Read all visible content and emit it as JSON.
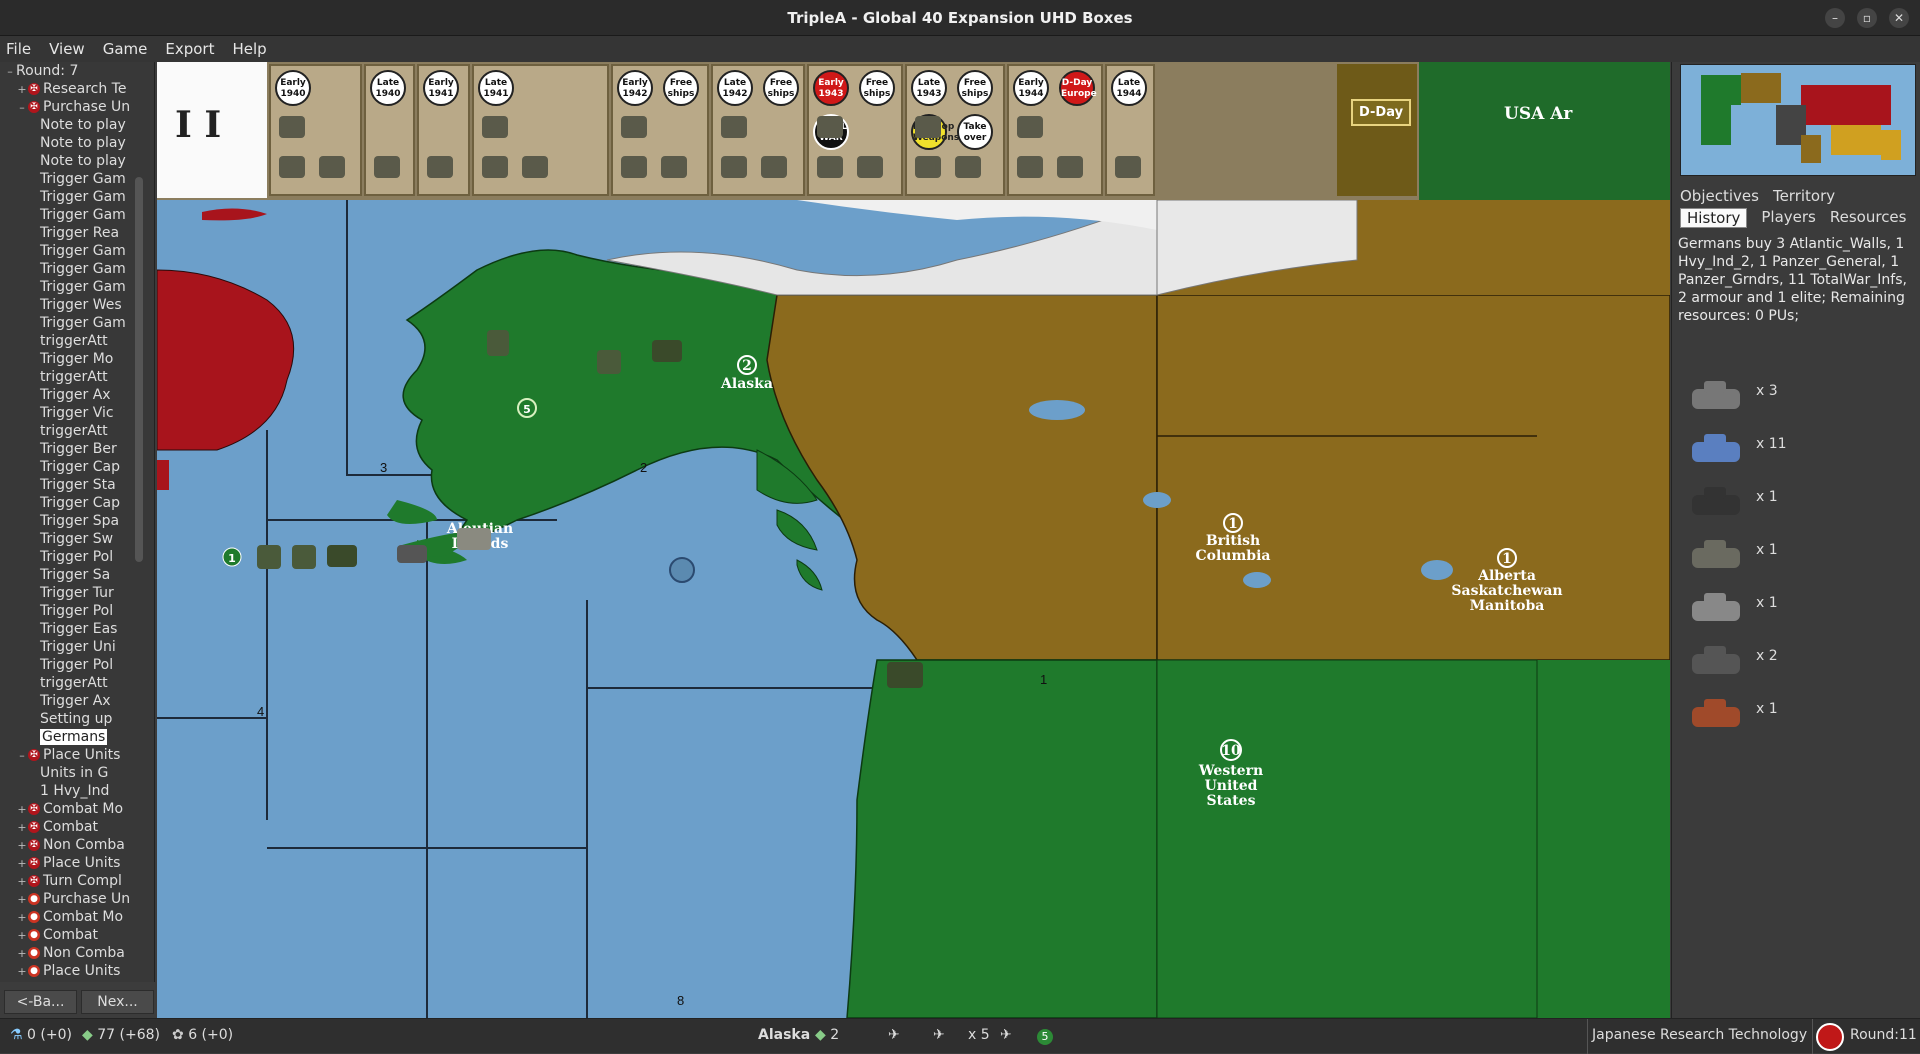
{
  "window": {
    "title": "TripleA - Global 40 Expansion UHD Boxes",
    "controls": [
      "–",
      "▫",
      "✕"
    ]
  },
  "menu": [
    "File",
    "View",
    "Game",
    "Export",
    "Help"
  ],
  "tree": {
    "items": [
      {
        "exp": "–",
        "icon": "",
        "label": "Round: 7",
        "indent": 0
      },
      {
        "exp": "+",
        "icon": "cross",
        "label": "Research Te",
        "indent": 1
      },
      {
        "exp": "–",
        "icon": "cross",
        "label": "Purchase Un",
        "indent": 1
      },
      {
        "exp": "",
        "icon": "",
        "label": "Note to play",
        "indent": 2
      },
      {
        "exp": "",
        "icon": "",
        "label": "Note to play",
        "indent": 2
      },
      {
        "exp": "",
        "icon": "",
        "label": "Note to play",
        "indent": 2
      },
      {
        "exp": "",
        "icon": "",
        "label": "Trigger Gam",
        "indent": 2
      },
      {
        "exp": "",
        "icon": "",
        "label": "Trigger Gam",
        "indent": 2
      },
      {
        "exp": "",
        "icon": "",
        "label": "Trigger Gam",
        "indent": 2
      },
      {
        "exp": "",
        "icon": "",
        "label": "Trigger Rea",
        "indent": 2
      },
      {
        "exp": "",
        "icon": "",
        "label": "Trigger Gam",
        "indent": 2
      },
      {
        "exp": "",
        "icon": "",
        "label": "Trigger Gam",
        "indent": 2
      },
      {
        "exp": "",
        "icon": "",
        "label": "Trigger Gam",
        "indent": 2
      },
      {
        "exp": "",
        "icon": "",
        "label": "Trigger Wes",
        "indent": 2
      },
      {
        "exp": "",
        "icon": "",
        "label": "Trigger Gam",
        "indent": 2
      },
      {
        "exp": "",
        "icon": "",
        "label": "triggerAtt",
        "indent": 2
      },
      {
        "exp": "",
        "icon": "",
        "label": "Trigger Mo",
        "indent": 2
      },
      {
        "exp": "",
        "icon": "",
        "label": "triggerAtt",
        "indent": 2
      },
      {
        "exp": "",
        "icon": "",
        "label": "Trigger Ax",
        "indent": 2
      },
      {
        "exp": "",
        "icon": "",
        "label": "Trigger Vic",
        "indent": 2
      },
      {
        "exp": "",
        "icon": "",
        "label": "triggerAtt",
        "indent": 2
      },
      {
        "exp": "",
        "icon": "",
        "label": "Trigger Ber",
        "indent": 2
      },
      {
        "exp": "",
        "icon": "",
        "label": "Trigger Cap",
        "indent": 2
      },
      {
        "exp": "",
        "icon": "",
        "label": "Trigger Sta",
        "indent": 2
      },
      {
        "exp": "",
        "icon": "",
        "label": "Trigger Cap",
        "indent": 2
      },
      {
        "exp": "",
        "icon": "",
        "label": "Trigger Spa",
        "indent": 2
      },
      {
        "exp": "",
        "icon": "",
        "label": "Trigger Sw",
        "indent": 2
      },
      {
        "exp": "",
        "icon": "",
        "label": "Trigger Pol",
        "indent": 2
      },
      {
        "exp": "",
        "icon": "",
        "label": "Trigger Sa",
        "indent": 2
      },
      {
        "exp": "",
        "icon": "",
        "label": "Trigger Tur",
        "indent": 2
      },
      {
        "exp": "",
        "icon": "",
        "label": "Trigger Pol",
        "indent": 2
      },
      {
        "exp": "",
        "icon": "",
        "label": "Trigger Eas",
        "indent": 2
      },
      {
        "exp": "",
        "icon": "",
        "label": "Trigger Uni",
        "indent": 2
      },
      {
        "exp": "",
        "icon": "",
        "label": "Trigger Pol",
        "indent": 2
      },
      {
        "exp": "",
        "icon": "",
        "label": "triggerAtt",
        "indent": 2
      },
      {
        "exp": "",
        "icon": "",
        "label": "Trigger Ax",
        "indent": 2
      },
      {
        "exp": "",
        "icon": "",
        "label": "Setting up",
        "indent": 2
      },
      {
        "exp": "",
        "icon": "",
        "label": "Germans",
        "indent": 2,
        "selected": true
      },
      {
        "exp": "–",
        "icon": "cross",
        "label": "Place Units",
        "indent": 1
      },
      {
        "exp": "",
        "icon": "",
        "label": "Units in G",
        "indent": 2
      },
      {
        "exp": "",
        "icon": "",
        "label": "1 Hvy_Ind",
        "indent": 2
      },
      {
        "exp": "+",
        "icon": "cross",
        "label": "Combat Mo",
        "indent": 1
      },
      {
        "exp": "+",
        "icon": "cross",
        "label": "Combat",
        "indent": 1
      },
      {
        "exp": "+",
        "icon": "cross",
        "label": "Non Comba",
        "indent": 1
      },
      {
        "exp": "+",
        "icon": "cross",
        "label": "Place Units",
        "indent": 1
      },
      {
        "exp": "+",
        "icon": "cross",
        "label": "Turn Compl",
        "indent": 1
      },
      {
        "exp": "+",
        "icon": "jp",
        "label": "Purchase Un",
        "indent": 1
      },
      {
        "exp": "+",
        "icon": "jp",
        "label": "Combat Mo",
        "indent": 1
      },
      {
        "exp": "+",
        "icon": "jp",
        "label": "Combat",
        "indent": 1
      },
      {
        "exp": "+",
        "icon": "jp",
        "label": "Non Comba",
        "indent": 1
      },
      {
        "exp": "+",
        "icon": "jp",
        "label": "Place Units",
        "indent": 1
      }
    ],
    "back_label": "<-Ba...",
    "next_label": "Nex..."
  },
  "tech_strip": {
    "roman": "I I",
    "boxes": [
      {
        "badges": [
          "Early 1940"
        ]
      },
      {
        "badges": [
          "Late 1940"
        ]
      },
      {
        "badges": [
          "Early 1941"
        ]
      },
      {
        "badges": [
          "Late 1941"
        ]
      },
      {
        "badges": [
          "Early 1942",
          "Free ships"
        ]
      },
      {
        "badges": [
          "Late 1942",
          "Free ships"
        ]
      },
      {
        "badges": [
          "Early 1943",
          "Free ships",
          "TOTAL WAR"
        ]
      },
      {
        "badges": [
          "Late 1943",
          "Free ships",
          "Develop Weapons",
          "Take over"
        ]
      },
      {
        "badges": [
          "Early 1944",
          "D-Day Europe"
        ]
      },
      {
        "badges": [
          "Late 1944"
        ]
      }
    ],
    "dday_label": "D-Day",
    "usa_label": "USA Ar"
  },
  "map": {
    "territories": [
      {
        "name": "Alaska",
        "value": "2"
      },
      {
        "name": "British Columbia",
        "value": "1"
      },
      {
        "name": "Alberta Saskatchewan Manitoba",
        "value": "1"
      },
      {
        "name": "Western United States",
        "value": "10"
      },
      {
        "name": "Aleutian Islands",
        "value": ""
      }
    ],
    "sea_zone_numbers": [
      "3",
      "2",
      "4",
      "1",
      "8"
    ],
    "unit_counts": [
      "5",
      "5",
      "1",
      "3",
      "2"
    ]
  },
  "right_panel": {
    "tabs_row1": [
      "Objectives",
      "Territory"
    ],
    "tabs_row2": [
      "History",
      "Players",
      "Resources"
    ],
    "history_text": "Germans buy 3 Atlantic_Walls, 1 Hvy_Ind_2, 1 Panzer_General, 1 Panzer_Grndrs, 11 TotalWar_Infs, 2 armour and 1 elite; Remaining resources: 0 PUs;",
    "units": [
      {
        "name": "atlantic-wall",
        "count": "x 3"
      },
      {
        "name": "totalwar-infantry",
        "count": "x 11"
      },
      {
        "name": "panzer-grenadier",
        "count": "x 1"
      },
      {
        "name": "panzer-general",
        "count": "x 1"
      },
      {
        "name": "elite-tank",
        "count": "x 1"
      },
      {
        "name": "armour",
        "count": "x 2"
      },
      {
        "name": "heavy-industry",
        "count": "x 1"
      }
    ]
  },
  "status_bar": {
    "pus": "0 (+0)",
    "income": "77 (+68)",
    "tech": "6 (+0)",
    "territory": "Alaska",
    "territory_value": "2",
    "units_count": "x 5",
    "zone_marker": "5",
    "phase": "Japanese Research Technology",
    "round": "Round:11"
  },
  "colors": {
    "us_green": "#1f7a2c",
    "british_ochre": "#8b6a1d",
    "soviet_red": "#a8141c",
    "sea_blue": "#6b9ec9",
    "ice": "#e6e6e6"
  }
}
